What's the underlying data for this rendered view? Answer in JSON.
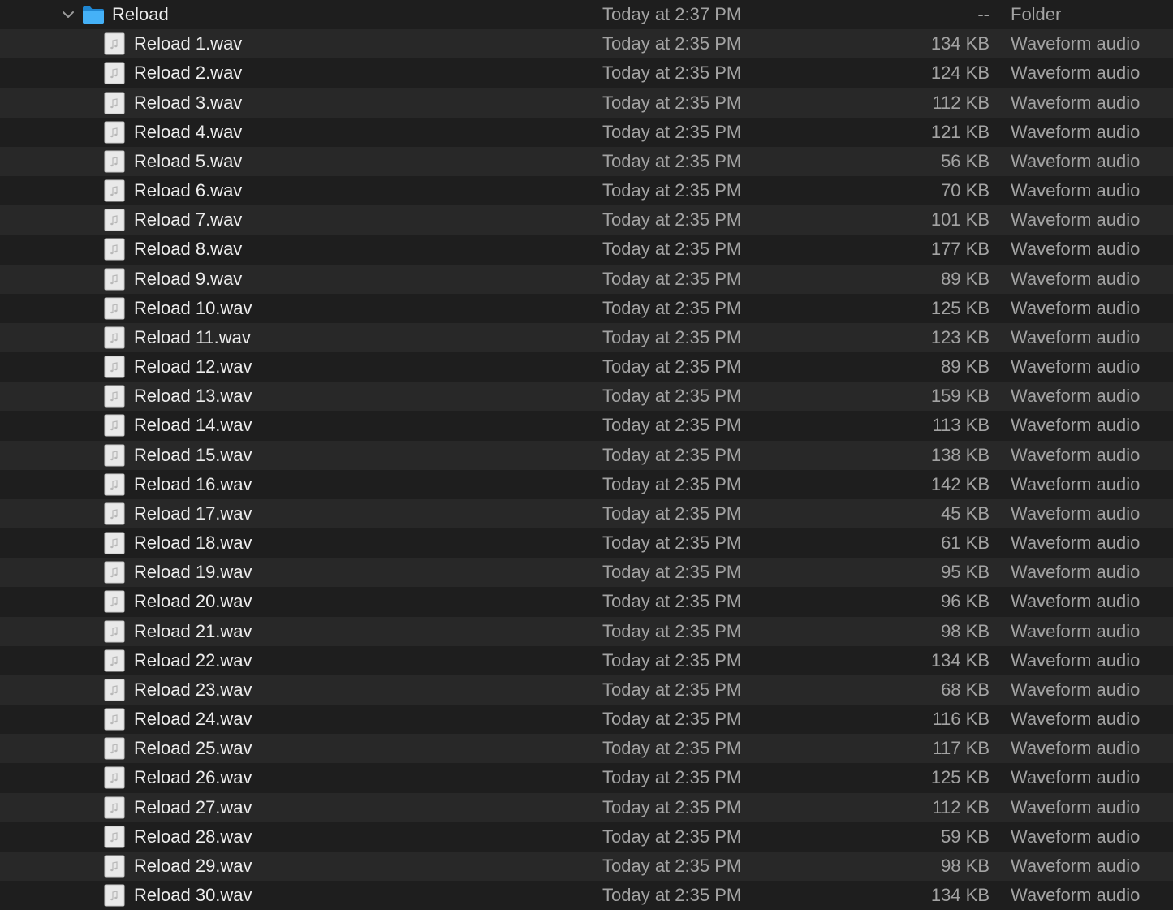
{
  "folder": {
    "name": "Reload",
    "date": "Today at 2:37 PM",
    "size": "--",
    "kind": "Folder"
  },
  "files": [
    {
      "name": "Reload 1.wav",
      "date": "Today at 2:35 PM",
      "size": "134 KB",
      "kind": "Waveform audio"
    },
    {
      "name": "Reload 2.wav",
      "date": "Today at 2:35 PM",
      "size": "124 KB",
      "kind": "Waveform audio"
    },
    {
      "name": "Reload 3.wav",
      "date": "Today at 2:35 PM",
      "size": "112 KB",
      "kind": "Waveform audio"
    },
    {
      "name": "Reload 4.wav",
      "date": "Today at 2:35 PM",
      "size": "121 KB",
      "kind": "Waveform audio"
    },
    {
      "name": "Reload 5.wav",
      "date": "Today at 2:35 PM",
      "size": "56 KB",
      "kind": "Waveform audio"
    },
    {
      "name": "Reload 6.wav",
      "date": "Today at 2:35 PM",
      "size": "70 KB",
      "kind": "Waveform audio"
    },
    {
      "name": "Reload 7.wav",
      "date": "Today at 2:35 PM",
      "size": "101 KB",
      "kind": "Waveform audio"
    },
    {
      "name": "Reload 8.wav",
      "date": "Today at 2:35 PM",
      "size": "177 KB",
      "kind": "Waveform audio"
    },
    {
      "name": "Reload 9.wav",
      "date": "Today at 2:35 PM",
      "size": "89 KB",
      "kind": "Waveform audio"
    },
    {
      "name": "Reload 10.wav",
      "date": "Today at 2:35 PM",
      "size": "125 KB",
      "kind": "Waveform audio"
    },
    {
      "name": "Reload 11.wav",
      "date": "Today at 2:35 PM",
      "size": "123 KB",
      "kind": "Waveform audio"
    },
    {
      "name": "Reload 12.wav",
      "date": "Today at 2:35 PM",
      "size": "89 KB",
      "kind": "Waveform audio"
    },
    {
      "name": "Reload 13.wav",
      "date": "Today at 2:35 PM",
      "size": "159 KB",
      "kind": "Waveform audio"
    },
    {
      "name": "Reload 14.wav",
      "date": "Today at 2:35 PM",
      "size": "113 KB",
      "kind": "Waveform audio"
    },
    {
      "name": "Reload 15.wav",
      "date": "Today at 2:35 PM",
      "size": "138 KB",
      "kind": "Waveform audio"
    },
    {
      "name": "Reload 16.wav",
      "date": "Today at 2:35 PM",
      "size": "142 KB",
      "kind": "Waveform audio"
    },
    {
      "name": "Reload 17.wav",
      "date": "Today at 2:35 PM",
      "size": "45 KB",
      "kind": "Waveform audio"
    },
    {
      "name": "Reload 18.wav",
      "date": "Today at 2:35 PM",
      "size": "61 KB",
      "kind": "Waveform audio"
    },
    {
      "name": "Reload 19.wav",
      "date": "Today at 2:35 PM",
      "size": "95 KB",
      "kind": "Waveform audio"
    },
    {
      "name": "Reload 20.wav",
      "date": "Today at 2:35 PM",
      "size": "96 KB",
      "kind": "Waveform audio"
    },
    {
      "name": "Reload 21.wav",
      "date": "Today at 2:35 PM",
      "size": "98 KB",
      "kind": "Waveform audio"
    },
    {
      "name": "Reload 22.wav",
      "date": "Today at 2:35 PM",
      "size": "134 KB",
      "kind": "Waveform audio"
    },
    {
      "name": "Reload 23.wav",
      "date": "Today at 2:35 PM",
      "size": "68 KB",
      "kind": "Waveform audio"
    },
    {
      "name": "Reload 24.wav",
      "date": "Today at 2:35 PM",
      "size": "116 KB",
      "kind": "Waveform audio"
    },
    {
      "name": "Reload 25.wav",
      "date": "Today at 2:35 PM",
      "size": "117 KB",
      "kind": "Waveform audio"
    },
    {
      "name": "Reload 26.wav",
      "date": "Today at 2:35 PM",
      "size": "125 KB",
      "kind": "Waveform audio"
    },
    {
      "name": "Reload 27.wav",
      "date": "Today at 2:35 PM",
      "size": "112 KB",
      "kind": "Waveform audio"
    },
    {
      "name": "Reload 28.wav",
      "date": "Today at 2:35 PM",
      "size": "59 KB",
      "kind": "Waveform audio"
    },
    {
      "name": "Reload 29.wav",
      "date": "Today at 2:35 PM",
      "size": "98 KB",
      "kind": "Waveform audio"
    },
    {
      "name": "Reload 30.wav",
      "date": "Today at 2:35 PM",
      "size": "134 KB",
      "kind": "Waveform audio"
    }
  ],
  "icons": {
    "disclosure": "chevron-down-icon",
    "folder": "folder-icon",
    "file": "audio-file-icon"
  },
  "colors": {
    "background": "#1e1e1e",
    "row_alternate": "#282828",
    "folder_blue": "#3fa9f5",
    "text_primary": "#ececec",
    "text_secondary": "#a3a3a3"
  }
}
